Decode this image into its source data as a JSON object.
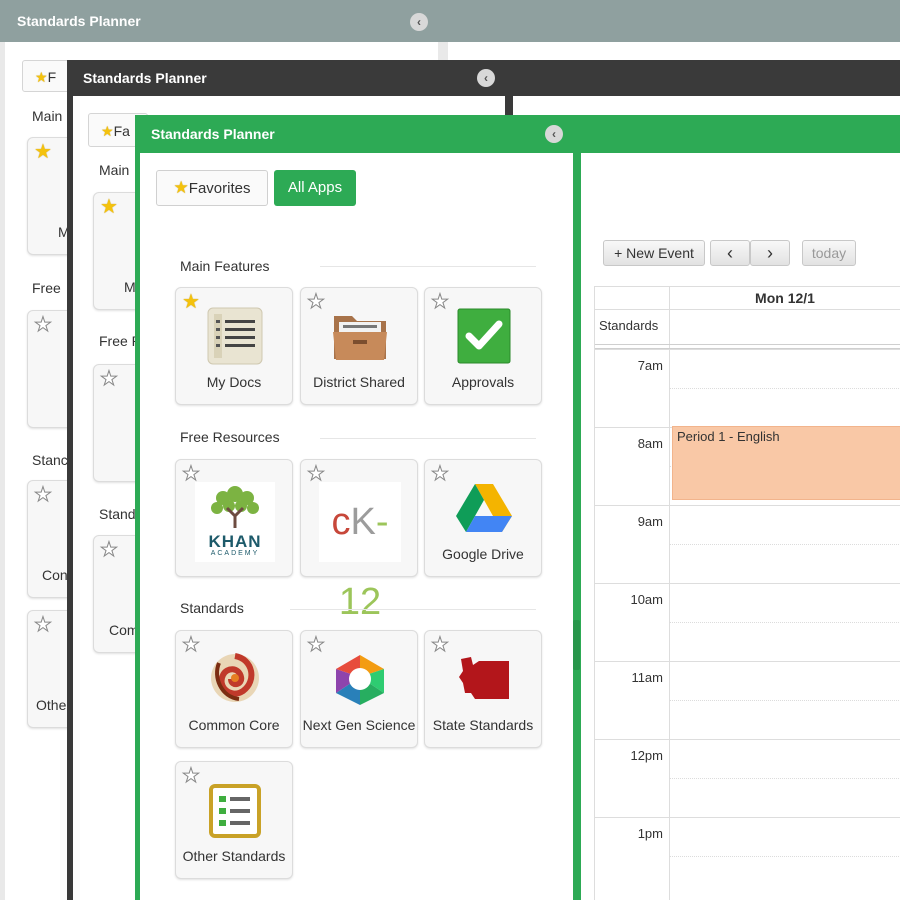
{
  "app_title": "Standards Planner",
  "close_glyph": "‹",
  "tabs": {
    "favorites": "Favorites",
    "all_apps": "All Apps"
  },
  "sections": {
    "main": "Main Features",
    "free": "Free Resources",
    "standards": "Standards"
  },
  "back_labels": {
    "fav_partial_1": "F",
    "fav_partial_2": "Fa",
    "main_partial": "Main",
    "free_partial": "Free R",
    "free_partial_back": "Free",
    "stand_partial": "Stand",
    "stand_partial_back": "Stanc",
    "m_label": "M",
    "com_label": "Com",
    "com_label_back": "Con",
    "other_label": "Othe"
  },
  "apps": {
    "my_docs": {
      "label": "My Docs",
      "favorite": true,
      "icon": "document-list-icon"
    },
    "district_shared": {
      "label": "District Shared",
      "favorite": false,
      "icon": "folder-icon"
    },
    "approvals": {
      "label": "Approvals",
      "favorite": false,
      "icon": "checkmark-icon"
    },
    "khan": {
      "label": "",
      "favorite": false,
      "icon": "khan-academy-logo",
      "logo_text": "KHAN",
      "logo_sub": "ACADEMY"
    },
    "ck12": {
      "label": "",
      "favorite": false,
      "icon": "ck12-logo",
      "logo_text_a": "c",
      "logo_text_b": "K",
      "logo_text_c": "-12"
    },
    "google_drive": {
      "label": "Google Drive",
      "favorite": false,
      "icon": "google-drive-icon"
    },
    "common_core": {
      "label": "Common Core",
      "favorite": false,
      "icon": "common-core-icon"
    },
    "next_gen": {
      "label": "Next Gen Science",
      "favorite": false,
      "icon": "next-gen-science-icon"
    },
    "state_standards": {
      "label": "State Standards",
      "favorite": false,
      "icon": "state-map-icon"
    },
    "other_standards": {
      "label": "Other Standards",
      "favorite": false,
      "icon": "checklist-icon"
    }
  },
  "calendar": {
    "new_event": "+ New Event",
    "prev": "‹",
    "next": "›",
    "today": "today",
    "day_header": "Mon 12/1",
    "allday_label": "Standards",
    "hours": [
      "7am",
      "8am",
      "9am",
      "10am",
      "11am",
      "12pm",
      "1pm"
    ],
    "event": {
      "title": "Period 1 - English",
      "color": "#f9c8a6"
    }
  },
  "colors": {
    "green": "#2daa55",
    "dark": "#3a3a3a",
    "gray": "#8fa09f"
  }
}
